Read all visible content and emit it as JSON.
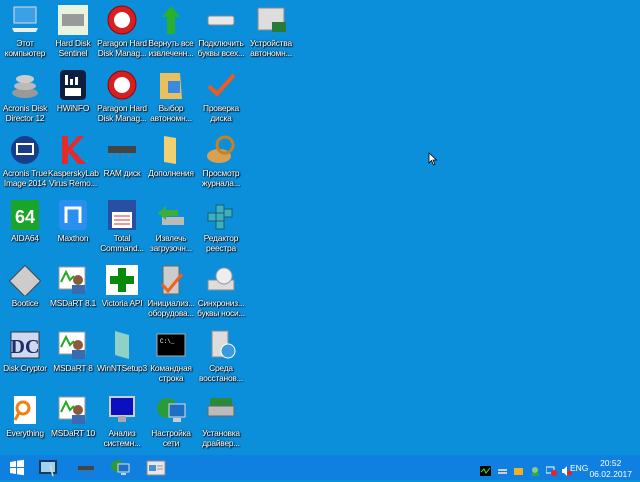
{
  "desktop": {
    "columns": [
      [
        {
          "label": "Этот\nкомпьютер",
          "icon": "computer-icon"
        },
        {
          "label": "Acronis Disk\nDirector 12",
          "icon": "acronis-disk-icon"
        },
        {
          "label": "Acronis True\nImage 2014",
          "icon": "acronis-true-image-icon"
        },
        {
          "label": "AIDA64",
          "icon": "aida64-icon"
        },
        {
          "label": "Bootice",
          "icon": "bootice-icon"
        },
        {
          "label": "Disk Cryptor",
          "icon": "disk-cryptor-icon"
        },
        {
          "label": "Everything",
          "icon": "everything-icon"
        }
      ],
      [
        {
          "label": "Hard Disk\nSentinel",
          "icon": "hard-disk-sentinel-icon"
        },
        {
          "label": "HWiNFO",
          "icon": "hwinfo-icon"
        },
        {
          "label": "KasperskyLab\nVirus Remo...",
          "icon": "kaspersky-icon"
        },
        {
          "label": "Maxthon",
          "icon": "maxthon-icon"
        },
        {
          "label": "MSDaRT 8.1",
          "icon": "msdart-icon"
        },
        {
          "label": "MSDaRT 8",
          "icon": "msdart-icon"
        },
        {
          "label": "MSDaRT 10",
          "icon": "msdart-icon"
        }
      ],
      [
        {
          "label": "Paragon Hard\nDisk Manag...",
          "icon": "paragon-icon"
        },
        {
          "label": "Paragon Hard\nDisk Manag...",
          "icon": "paragon-icon"
        },
        {
          "label": "RAM диск",
          "icon": "ram-disk-icon"
        },
        {
          "label": "Total\nCommand...",
          "icon": "total-commander-icon"
        },
        {
          "label": "Victoria API",
          "icon": "victoria-icon"
        },
        {
          "label": "WinNTSetup3",
          "icon": "winntsetup-icon"
        },
        {
          "label": "Анализ\nсистемн...",
          "icon": "monitor-icon"
        }
      ],
      [
        {
          "label": "Вернуть все\nизвлеченн...",
          "icon": "green-arrow-icon"
        },
        {
          "label": "Выбор\nавтономн...",
          "icon": "windows-folder-icon"
        },
        {
          "label": "Дополнения",
          "icon": "folder-icon"
        },
        {
          "label": "Извлечь\nзагрузочн...",
          "icon": "eject-drive-icon"
        },
        {
          "label": "Инициализ...\nоборудова...",
          "icon": "hardware-init-icon"
        },
        {
          "label": "Командная\nстрока",
          "icon": "cmd-icon"
        },
        {
          "label": "Настройка\nсети",
          "icon": "network-icon"
        }
      ],
      [
        {
          "label": "Подключить\nбуквы всех...",
          "icon": "drive-icon"
        },
        {
          "label": "Проверка\nдиска",
          "icon": "checkmark-icon"
        },
        {
          "label": "Просмотр\nжурнала...",
          "icon": "log-viewer-icon"
        },
        {
          "label": "Редактор\nреестра",
          "icon": "regedit-icon"
        },
        {
          "label": "Синхрониз...\nбуквы носи...",
          "icon": "cd-drive-icon"
        },
        {
          "label": "Среда\nвосстанов...",
          "icon": "recovery-icon"
        },
        {
          "label": "Установка\nдрайвер...",
          "icon": "driver-install-icon"
        }
      ],
      [
        {
          "label": "Устройства\nавтономн...",
          "icon": "devices-icon"
        }
      ]
    ]
  },
  "taskbar": {
    "items": [
      "start-icon",
      "explorer-pinned-icon",
      "ram-pinned-icon",
      "network-pinned-icon",
      "window-pinned-icon"
    ],
    "tray": [
      "monitor-tray-icon",
      "network-tray-icon",
      "folder-tray-icon",
      "user-tray-icon",
      "network-disconnected-icon",
      "volume-muted-icon"
    ],
    "lang": "ENG",
    "time": "20:52",
    "date": "06.02.2017"
  }
}
